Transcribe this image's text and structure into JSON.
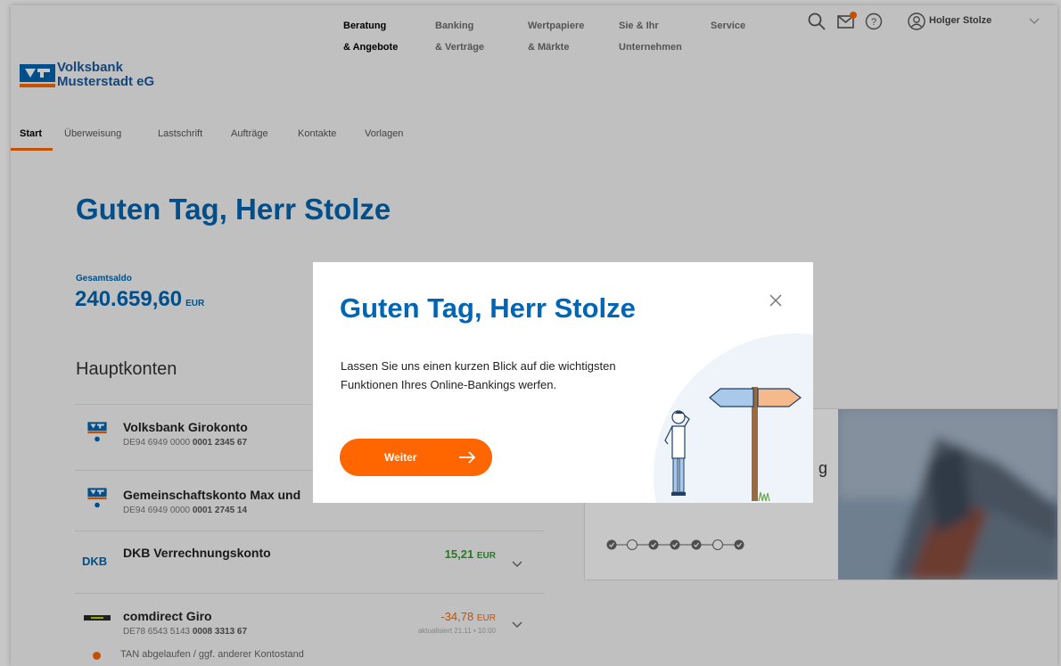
{
  "nav": {
    "items": [
      {
        "line1": "Beratung",
        "line2": "& Angebote"
      },
      {
        "line1": "Banking",
        "line2": "& Verträge"
      },
      {
        "line1": "Wertpapiere",
        "line2": "& Märkte"
      },
      {
        "line1": "Sie & Ihr",
        "line2": "Unternehmen"
      },
      {
        "line1": "Service",
        "line2": ""
      }
    ],
    "icons": [
      "search-icon",
      "mail-icon",
      "help-icon",
      "user-icon"
    ],
    "mail_badge_color": "#ff6600",
    "user_name": "Holger Stolze"
  },
  "logo": {
    "line1": "Volksbank",
    "line2": "Musterstadt eG",
    "brand_blue": "#0066b3",
    "brand_orange": "#ff6600"
  },
  "tabs": [
    "Start",
    "Überweisung",
    "Lastschrift",
    "Aufträge",
    "Kontakte",
    "Vorlagen"
  ],
  "greeting": "Guten Tag, Herr Stolze",
  "balance": {
    "label": "Gesamtsaldo",
    "value": "240.659,60",
    "currency": "EUR"
  },
  "section_title": "Hauptkonten",
  "accounts": [
    {
      "name": "Volksbank Girokonto",
      "iban_prefix": "DE94 6949 0000",
      "iban_suffix": "0001 2345 67"
    },
    {
      "name": "Gemeinschaftskonto Max und",
      "iban_prefix": "DE94 6949 0000",
      "iban_suffix": "0001 2745 14"
    },
    {
      "name": "DKB Verrechnungskonto",
      "logo": "DKB",
      "amount": "15,21",
      "currency": "EUR"
    },
    {
      "name": "comdirect Giro",
      "iban_prefix": "DE78 6543 5143",
      "iban_suffix": "0008 3313 67",
      "amount": "-34,78",
      "currency": "EUR",
      "updated": "aktualisiert 21.11 • 10:00"
    }
  ],
  "tan_note": "TAN abgelaufen / ggf. anderer Kontostand",
  "card": {
    "partial_text": "g",
    "progress_steps": [
      true,
      false,
      true,
      true,
      true,
      false,
      true
    ]
  },
  "modal": {
    "title": "Guten Tag, Herr Stolze",
    "text": "Lassen Sie uns einen kurzen Blick auf die wichtigsten Funktionen Ihres Online-Bankings werfen.",
    "button": "Weiter"
  }
}
